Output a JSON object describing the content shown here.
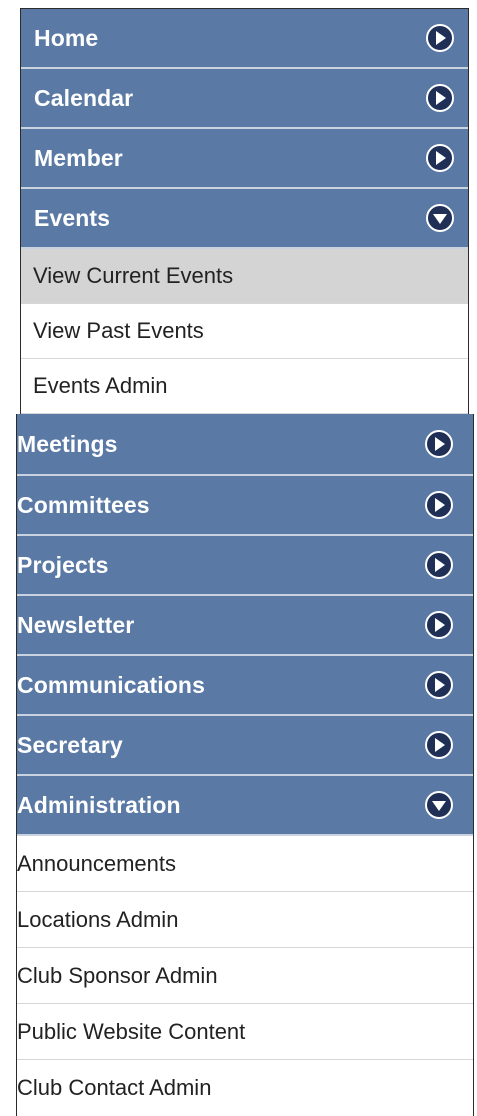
{
  "top_menu": {
    "sections": [
      {
        "label": "Home",
        "state": "collapsed"
      },
      {
        "label": "Calendar",
        "state": "collapsed"
      },
      {
        "label": "Member",
        "state": "collapsed"
      },
      {
        "label": "Events",
        "state": "expanded"
      }
    ],
    "events_items": [
      {
        "label": "View Current Events",
        "active": true
      },
      {
        "label": "View Past Events",
        "active": false
      },
      {
        "label": "Events Admin",
        "active": false
      }
    ]
  },
  "bottom_menu": {
    "sections": [
      {
        "label": "Meetings",
        "state": "collapsed"
      },
      {
        "label": "Committees",
        "state": "collapsed"
      },
      {
        "label": "Projects",
        "state": "collapsed"
      },
      {
        "label": "Newsletter",
        "state": "collapsed"
      },
      {
        "label": "Communications",
        "state": "collapsed"
      },
      {
        "label": "Secretary",
        "state": "collapsed"
      },
      {
        "label": "Administration",
        "state": "expanded"
      }
    ],
    "administration_items": [
      {
        "label": "Announcements"
      },
      {
        "label": "Locations Admin"
      },
      {
        "label": "Club Sponsor Admin"
      },
      {
        "label": "Public Website Content"
      },
      {
        "label": "Club Contact Admin"
      }
    ]
  },
  "icons": {
    "collapsed": "chevron-right-circle-icon",
    "expanded": "chevron-down-circle-icon"
  },
  "colors": {
    "section_bg": "#5a7aa5",
    "arrow_bg": "#1f2f56",
    "active_item_bg": "#d4d4d4"
  }
}
